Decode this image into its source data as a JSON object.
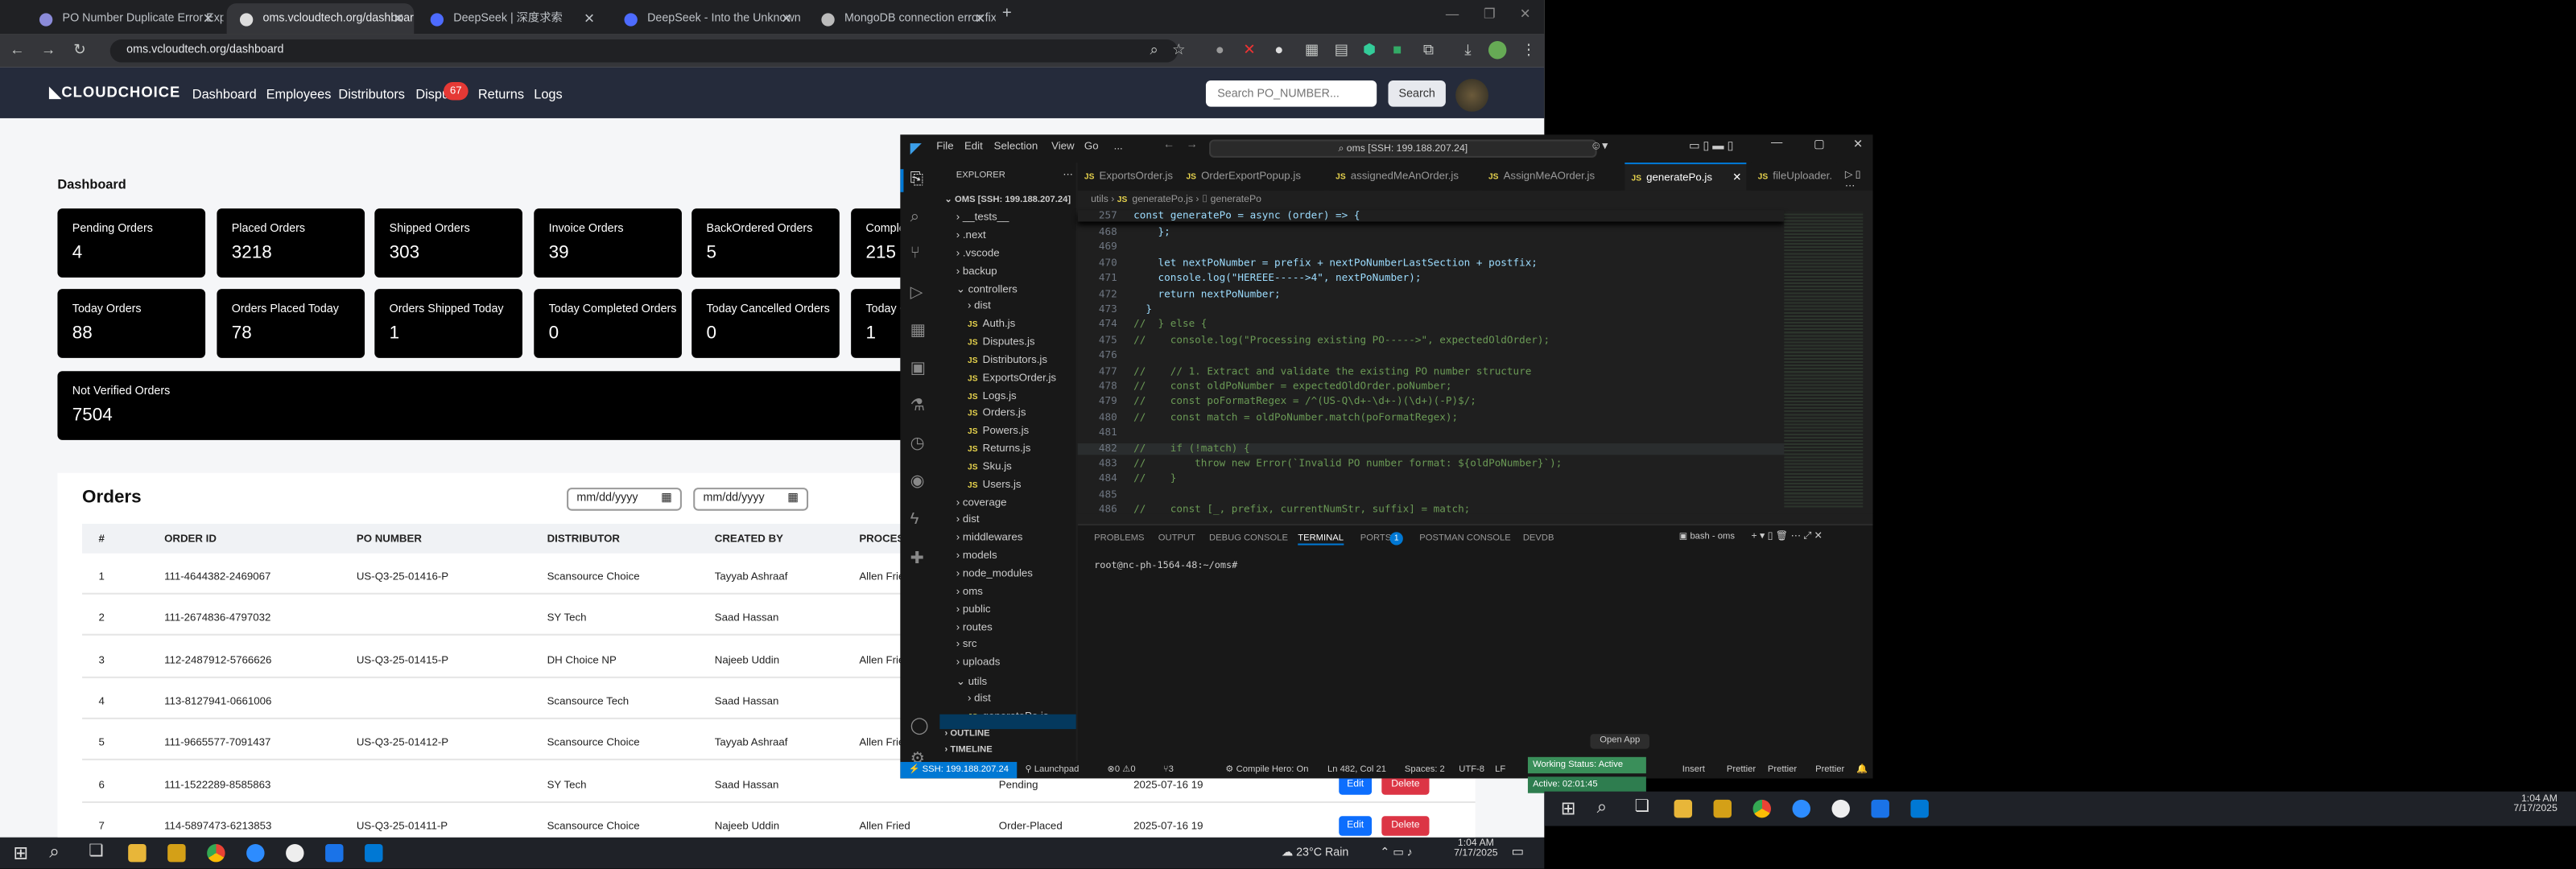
{
  "browser": {
    "tabs": [
      {
        "title": "PO Number Duplicate Error Exp"
      },
      {
        "title": "oms.vcloudtech.org/dashboard"
      },
      {
        "title": "DeepSeek | 深度求索"
      },
      {
        "title": "DeepSeek - Into the Unknown"
      },
      {
        "title": "MongoDB connection error fix"
      }
    ],
    "url": "oms.vcloudtech.org/dashboard"
  },
  "site": {
    "logo": "CLOUDCHOICE",
    "nav": [
      "Dashboard",
      "Employees",
      "Distributors",
      "Dispu",
      "Returns",
      "Logs"
    ],
    "disputes_badge": "67",
    "search_placeholder": "Search PO_NUMBER...",
    "search_button": "Search",
    "heading": "Dashboard",
    "cards_row1": [
      {
        "label": "Pending Orders",
        "value": "4"
      },
      {
        "label": "Placed Orders",
        "value": "3218"
      },
      {
        "label": "Shipped Orders",
        "value": "303"
      },
      {
        "label": "Invoice Orders",
        "value": "39"
      },
      {
        "label": "BackOrdered Orders",
        "value": "5"
      },
      {
        "label": "Comple",
        "value": "215"
      }
    ],
    "cards_row2": [
      {
        "label": "Today Orders",
        "value": "88"
      },
      {
        "label": "Orders Placed Today",
        "value": "78"
      },
      {
        "label": "Orders Shipped Today",
        "value": "1"
      },
      {
        "label": "Today Completed Orders",
        "value": "0"
      },
      {
        "label": "Today Cancelled Orders",
        "value": "0"
      },
      {
        "label": "Today C",
        "value": "1"
      }
    ],
    "not_verified": {
      "label": "Not Verified Orders",
      "value": "7504"
    },
    "orders_title": "Orders",
    "date_placeholder": "mm/dd/yyyy",
    "columns": [
      "#",
      "ORDER ID",
      "PO NUMBER",
      "DISTRIBUTOR",
      "CREATED BY",
      "PROCES"
    ],
    "rows": [
      {
        "n": "1",
        "id": "111-4644382-2469067",
        "po": "US-Q3-25-01416-P",
        "dist": "Scansource Choice",
        "by": "Tayyab Ashraaf",
        "proc": "Allen Frie",
        "status": "",
        "date": ""
      },
      {
        "n": "2",
        "id": "111-2674836-4797032",
        "po": "",
        "dist": "SY Tech",
        "by": "Saad Hassan",
        "proc": "",
        "status": "",
        "date": ""
      },
      {
        "n": "3",
        "id": "112-2487912-5766626",
        "po": "US-Q3-25-01415-P",
        "dist": "DH Choice NP",
        "by": "Najeeb Uddin",
        "proc": "Allen Frie",
        "status": "",
        "date": ""
      },
      {
        "n": "4",
        "id": "113-8127941-0661006",
        "po": "",
        "dist": "Scansource Tech",
        "by": "Saad Hassan",
        "proc": "",
        "status": "",
        "date": ""
      },
      {
        "n": "5",
        "id": "111-9665577-7091437",
        "po": "US-Q3-25-01412-P",
        "dist": "Scansource Choice",
        "by": "Tayyab Ashraaf",
        "proc": "Allen Frie",
        "status": "",
        "date": ""
      },
      {
        "n": "6",
        "id": "111-1522289-8585863",
        "po": "",
        "dist": "SY Tech",
        "by": "Saad Hassan",
        "proc": "",
        "status": "Pending",
        "date": "2025-07-16 19"
      },
      {
        "n": "7",
        "id": "114-5897473-6213853",
        "po": "US-Q3-25-01411-P",
        "dist": "Scansource Choice",
        "by": "Najeeb Uddin",
        "proc": "Allen Fried",
        "status": "Order-Placed",
        "date": "2025-07-16 19"
      }
    ],
    "edit_label": "Edit",
    "delete_label": "Delete"
  },
  "vscode": {
    "menu": [
      "File",
      "Edit",
      "Selection",
      "View",
      "Go",
      "..."
    ],
    "command_center": "oms [SSH: 199.188.207.24]",
    "explorer_title": "EXPLORER",
    "root": "OMS [SSH: 199.188.207.24]",
    "tree": [
      {
        "name": "__tests__",
        "kind": "folder",
        "depth": 1
      },
      {
        "name": ".next",
        "kind": "folder",
        "depth": 1
      },
      {
        "name": ".vscode",
        "kind": "folder",
        "depth": 1
      },
      {
        "name": "backup",
        "kind": "folder",
        "depth": 1
      },
      {
        "name": "controllers",
        "kind": "folder-open",
        "depth": 1
      },
      {
        "name": "dist",
        "kind": "folder",
        "depth": 2
      },
      {
        "name": "Auth.js",
        "kind": "js",
        "depth": 2
      },
      {
        "name": "Disputes.js",
        "kind": "js",
        "depth": 2
      },
      {
        "name": "Distributors.js",
        "kind": "js",
        "depth": 2
      },
      {
        "name": "ExportsOrder.js",
        "kind": "js",
        "depth": 2
      },
      {
        "name": "Logs.js",
        "kind": "js",
        "depth": 2
      },
      {
        "name": "Orders.js",
        "kind": "js",
        "depth": 2
      },
      {
        "name": "Powers.js",
        "kind": "js",
        "depth": 2
      },
      {
        "name": "Returns.js",
        "kind": "js",
        "depth": 2
      },
      {
        "name": "Sku.js",
        "kind": "js",
        "depth": 2
      },
      {
        "name": "Users.js",
        "kind": "js",
        "depth": 2
      },
      {
        "name": "coverage",
        "kind": "folder",
        "depth": 1
      },
      {
        "name": "dist",
        "kind": "folder",
        "depth": 1
      },
      {
        "name": "middlewares",
        "kind": "folder",
        "depth": 1
      },
      {
        "name": "models",
        "kind": "folder",
        "depth": 1
      },
      {
        "name": "node_modules",
        "kind": "folder",
        "depth": 1
      },
      {
        "name": "oms",
        "kind": "folder",
        "depth": 1
      },
      {
        "name": "public",
        "kind": "folder",
        "depth": 1
      },
      {
        "name": "routes",
        "kind": "folder",
        "depth": 1
      },
      {
        "name": "src",
        "kind": "folder",
        "depth": 1
      },
      {
        "name": "uploads",
        "kind": "folder",
        "depth": 1
      },
      {
        "name": "utils",
        "kind": "folder-open",
        "depth": 1
      },
      {
        "name": "dist",
        "kind": "folder",
        "depth": 2
      },
      {
        "name": "generatePo.js",
        "kind": "js",
        "depth": 2
      }
    ],
    "outline": "OUTLINE",
    "timeline": "TIMELINE",
    "editor_tabs": [
      "ExportsOrder.js",
      "OrderExportPopup.js",
      "assignedMeAnOrder.js",
      "AssignMeAOrder.js",
      "generatePo.js",
      "fileUploader."
    ],
    "breadcrumb": [
      "utils",
      "generatePo.js",
      "generatePo"
    ],
    "sticky": {
      "num": "257",
      "text": "const generatePo = async (order) => {"
    },
    "code": [
      {
        "num": "468",
        "text": "    };"
      },
      {
        "num": "469",
        "text": ""
      },
      {
        "num": "470",
        "text": "    let nextPoNumber = prefix + nextPoNumberLastSection + postfix;"
      },
      {
        "num": "471",
        "text": "    console.log(\"HEREEE----->4\", nextPoNumber);"
      },
      {
        "num": "472",
        "text": "    return nextPoNumber;"
      },
      {
        "num": "473",
        "text": "  }"
      },
      {
        "num": "474",
        "text": "//  } else {"
      },
      {
        "num": "475",
        "text": "//    console.log(\"Processing existing PO----->\", expectedOldOrder);"
      },
      {
        "num": "476",
        "text": ""
      },
      {
        "num": "477",
        "text": "//    // 1. Extract and validate the existing PO number structure"
      },
      {
        "num": "478",
        "text": "//    const oldPoNumber = expectedOldOrder.poNumber;"
      },
      {
        "num": "479",
        "text": "//    const poFormatRegex = /^(US-Q\\d+-\\d+-)(\\d+)(-P)$/;"
      },
      {
        "num": "480",
        "text": "//    const match = oldPoNumber.match(poFormatRegex);"
      },
      {
        "num": "481",
        "text": ""
      },
      {
        "num": "482",
        "text": "//    if (!match) {"
      },
      {
        "num": "483",
        "text": "//        throw new Error(`Invalid PO number format: ${oldPoNumber}`);"
      },
      {
        "num": "484",
        "text": "//    }"
      },
      {
        "num": "485",
        "text": ""
      },
      {
        "num": "486",
        "text": "//    const [_, prefix, currentNumStr, suffix] = match;"
      }
    ],
    "panel_tabs": [
      "PROBLEMS",
      "OUTPUT",
      "DEBUG CONSOLE",
      "TERMINAL",
      "PORTS",
      "POSTMAN CONSOLE",
      "DEVDB"
    ],
    "ports_badge": "1",
    "terminal_shell": "bash - oms",
    "terminal_prompt": "root@nc-ph-1564-48:~/oms#",
    "status": {
      "remote": "SSH: 199.188.207.24",
      "launchpad": "Launchpad",
      "errors": "0",
      "warnings": "0",
      "ports": "3",
      "compile": "Compile Hero: On",
      "position": "Ln 482, Col 21",
      "spaces": "Spaces: 2",
      "encoding": "UTF-8",
      "eol": "LF",
      "insert": "Insert",
      "prettier1": "Prettier",
      "prettier2": "Prettier",
      "prettier3": "Prettier"
    }
  },
  "widget": {
    "open_app": "Open App",
    "status": "Working Status: Active",
    "timer": "Active: 02:01:45"
  },
  "taskbar_left": {
    "weather": "23°C  Rain",
    "time": "1:04 AM",
    "date": "7/17/2025"
  },
  "taskbar_right": {
    "time": "1:04 AM",
    "date": "7/17/2025"
  }
}
